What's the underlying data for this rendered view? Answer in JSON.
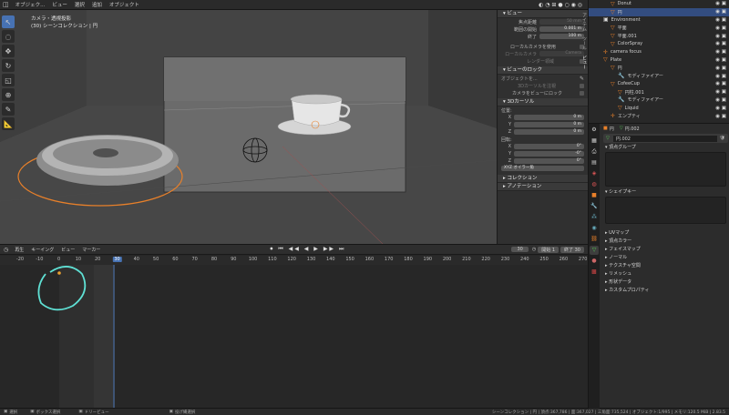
{
  "header": {
    "menus": [
      "ビュー",
      "選択",
      "追加",
      "オブジェクト"
    ],
    "mode_label": "オブジェク..."
  },
  "viewport": {
    "camera_title": "カメラ・透視投影",
    "collection_line": "(30) シーンコレクション | 円"
  },
  "npanel": {
    "view_section": "ビュー",
    "clip_start_label": "焦点距離",
    "clip_start_value": "50 mm",
    "clip_near_label": "範囲の開始",
    "clip_near_value": "0.001 m",
    "clip_end_label": "終了",
    "clip_end_value": "100 m",
    "local_camera_label": "ローカルカメラを使用",
    "local_camera2_label": "ローカルカメラ",
    "local_camera2_value": "Camera",
    "render_region_label": "レンダー領域",
    "view_lock_section": "ビューのロック",
    "lock_object_label": "オブジェクトを...",
    "lock_3dcursor_label": "3Dカーソルを注視",
    "lock_camera_label": "カメラをビューにロック",
    "cursor_section": "3Dカーソル",
    "location_label": "位置:",
    "x_label": "X",
    "x_value": "0 m",
    "y_label": "Y",
    "y_value": "0 m",
    "z_label": "Z",
    "z_value": "0 m",
    "rotation_label": "回転:",
    "rx_value": "0°",
    "ry_value": "-0°",
    "rz_value": "0°",
    "rotation_mode": "XYZ オイラー角",
    "collection_section": "コレクション",
    "annotation_section": "アノテーション",
    "tabs": [
      "アイテム",
      "ツール",
      "ビュー"
    ]
  },
  "timeline": {
    "menus": [
      "再生",
      "キーイング",
      "ビュー",
      "マーカー"
    ],
    "current_frame": "30",
    "start_label": "開始",
    "start_value": "1",
    "end_label": "終了",
    "end_value": "30",
    "ruler": [
      "-20",
      "-10",
      "0",
      "10",
      "20",
      "30",
      "40",
      "50",
      "60",
      "70",
      "80",
      "90",
      "100",
      "110",
      "120",
      "130",
      "140",
      "150",
      "160",
      "170",
      "180",
      "190",
      "200",
      "210",
      "220",
      "230",
      "240",
      "250",
      "260",
      "270",
      "280"
    ]
  },
  "status": {
    "select": "選択",
    "box_select": "ボックス選択",
    "dolly": "ドリービュー",
    "context": "投げ縄選択",
    "stats": "シーンコレクション | 円 | 頂点:367,786 | 面:367,027 | 三角面:735,524 | オブジェクト:1/995 | メモリ:120.5 MiB | 2.83.5"
  },
  "outliner": {
    "rows": [
      {
        "name": "Donut",
        "indent": 2,
        "icon": "mesh-icon",
        "selected": false
      },
      {
        "name": "円",
        "indent": 2,
        "icon": "mesh-icon",
        "selected": true
      },
      {
        "name": "Environment",
        "indent": 1,
        "icon": "collection-icon",
        "selected": false
      },
      {
        "name": "平面",
        "indent": 2,
        "icon": "mesh-icon",
        "selected": false
      },
      {
        "name": "平面.001",
        "indent": 2,
        "icon": "mesh-icon",
        "selected": false
      },
      {
        "name": "ColorSpray",
        "indent": 2,
        "icon": "mesh-icon",
        "selected": false
      },
      {
        "name": "camera focus",
        "indent": 1,
        "icon": "empty-icon",
        "selected": false
      },
      {
        "name": "Plate",
        "indent": 1,
        "icon": "mesh-icon",
        "selected": false
      },
      {
        "name": "円",
        "indent": 2,
        "icon": "mesh-icon",
        "selected": false
      },
      {
        "name": "モディファイアー",
        "indent": 3,
        "icon": "wrench-icon",
        "selected": false
      },
      {
        "name": "CofeeCup",
        "indent": 2,
        "icon": "mesh-icon",
        "selected": false
      },
      {
        "name": "円柱.001",
        "indent": 3,
        "icon": "mesh-icon",
        "selected": false
      },
      {
        "name": "モディファイアー",
        "indent": 3,
        "icon": "wrench-icon",
        "selected": false
      },
      {
        "name": "Liquid",
        "indent": 3,
        "icon": "mesh-icon",
        "selected": false
      },
      {
        "name": "エンプティ",
        "indent": 2,
        "icon": "empty-icon",
        "selected": false
      }
    ]
  },
  "properties": {
    "object_name": "円",
    "data_name": "円.002",
    "mesh_name": "円.002",
    "sections": [
      "頂点グループ",
      "シェイプキー",
      "UVマップ",
      "頂点カラー",
      "フェイスマップ",
      "ノーマル",
      "テクスチャ空間",
      "リメッシュ",
      "形状データ",
      "カスタムプロパティ"
    ]
  },
  "colors": {
    "accent": "#4772b3",
    "selection": "#334d80",
    "annotation": "#5fe0d4",
    "select_orange": "#e8802a"
  }
}
